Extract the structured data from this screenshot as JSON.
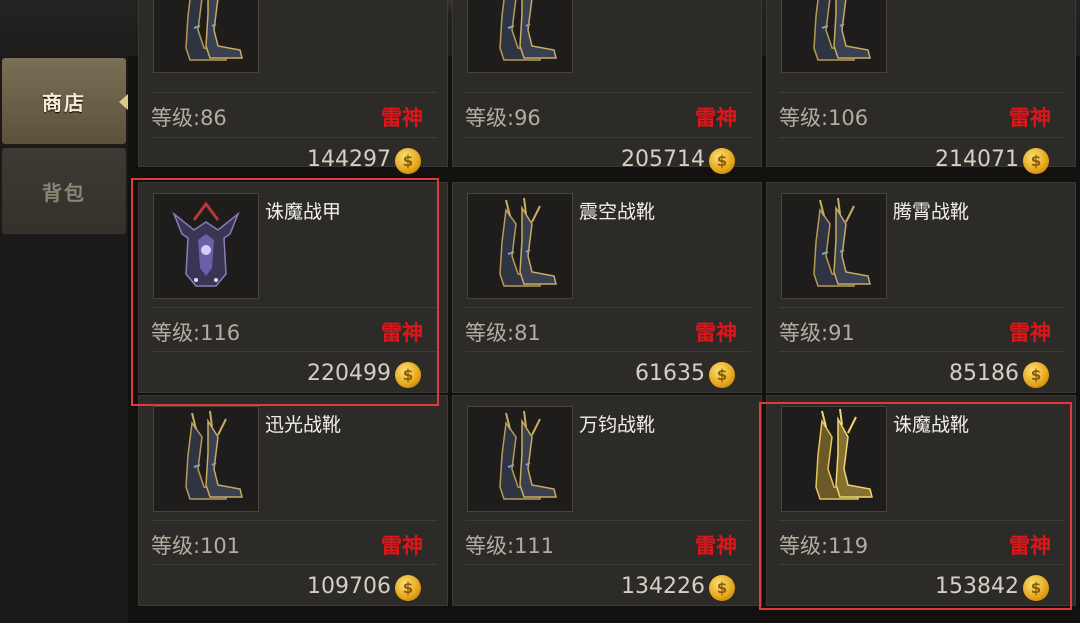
{
  "sidebar": {
    "tabs": [
      {
        "label": "商店",
        "active": true
      },
      {
        "label": "背包",
        "active": false
      }
    ]
  },
  "shop": {
    "items": [
      {
        "name": "",
        "level": "等级:86",
        "tag": "雷神",
        "price": "144297",
        "icon": "boots-icon"
      },
      {
        "name": "",
        "level": "等级:96",
        "tag": "雷神",
        "price": "205714",
        "icon": "boots-icon"
      },
      {
        "name": "",
        "level": "等级:106",
        "tag": "雷神",
        "price": "214071",
        "icon": "boots-icon"
      },
      {
        "name": "诛魔战甲",
        "level": "等级:116",
        "tag": "雷神",
        "price": "220499",
        "icon": "armor-icon",
        "highlighted": true
      },
      {
        "name": "震空战靴",
        "level": "等级:81",
        "tag": "雷神",
        "price": "61635",
        "icon": "boots-icon"
      },
      {
        "name": "腾霄战靴",
        "level": "等级:91",
        "tag": "雷神",
        "price": "85186",
        "icon": "boots-icon"
      },
      {
        "name": "迅光战靴",
        "level": "等级:101",
        "tag": "雷神",
        "price": "109706",
        "icon": "boots-icon"
      },
      {
        "name": "万钧战靴",
        "level": "等级:111",
        "tag": "雷神",
        "price": "134226",
        "icon": "boots-icon"
      },
      {
        "name": "诛魔战靴",
        "level": "等级:119",
        "tag": "雷神",
        "price": "153842",
        "icon": "gold-boots-icon",
        "highlighted": true
      }
    ]
  },
  "colors": {
    "tag": "#e0151a",
    "highlight": "#e23a3a",
    "coin": "#f0b52a"
  },
  "icons": {
    "close": "close-icon",
    "coin": "gold-coin-icon",
    "coin_glyph": "$"
  }
}
